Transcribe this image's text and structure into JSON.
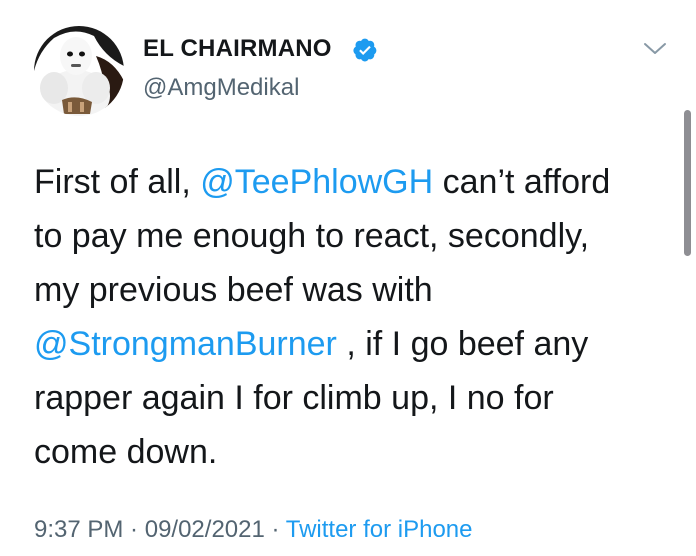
{
  "tweet": {
    "display_name": "EL CHAIRMANO",
    "handle": "@AmgMedikal",
    "verified": true,
    "text": {
      "l1_pre": "First of all, ",
      "l1_mention": "@TeePhlowGH",
      "l1_post": " can’t afford",
      "l2": "to pay me enough to react, secondly,",
      "l3": "my previous beef was with",
      "l4_mention": "@StrongmanBurner",
      "l4_post": " , if I go beef any",
      "l5": "rapper again I for climb up, I no for",
      "l6": "come down."
    },
    "time": "9:37 PM",
    "separator1": " · ",
    "date": "09/02/2021",
    "separator2": " · ",
    "source": "Twitter for iPhone"
  },
  "colors": {
    "text": "#14171a",
    "muted": "#536471",
    "link": "#1d9bf0",
    "verified": "#1d9bf0"
  },
  "icons": {
    "verified": "verified-badge-icon",
    "more": "chevron-down-icon",
    "avatar": "profile-avatar"
  }
}
